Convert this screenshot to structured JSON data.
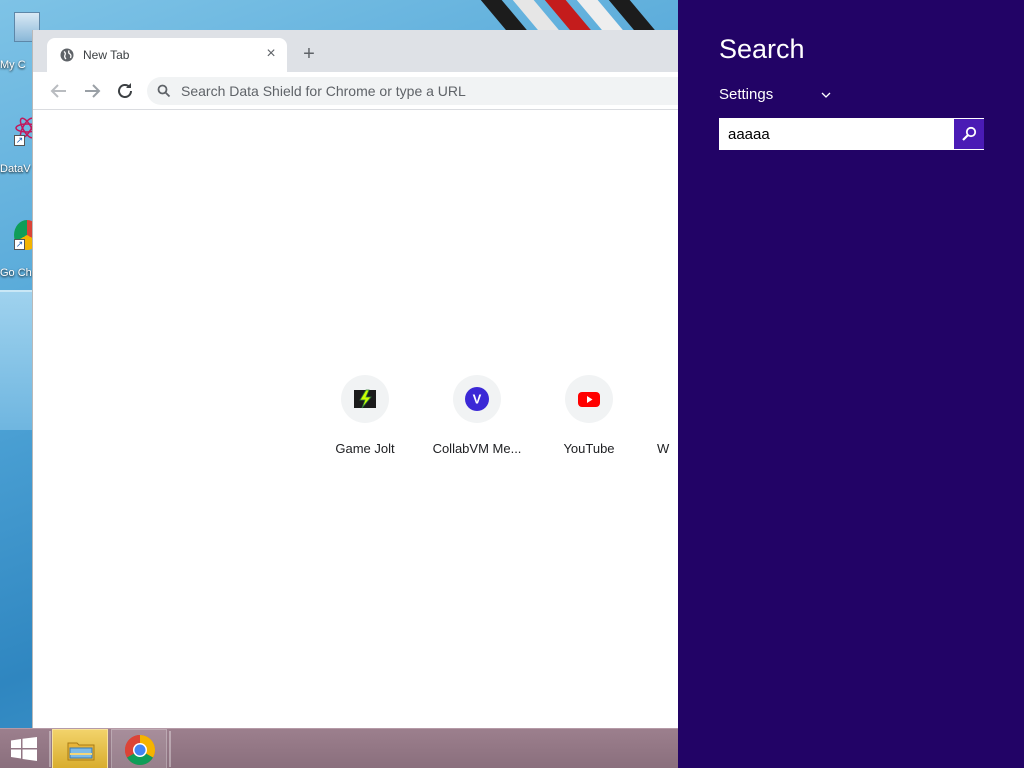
{
  "desktop": {
    "icons": [
      {
        "label": "My C",
        "icon": "my-computer-icon"
      },
      {
        "label": "DataV",
        "icon": "data-shield-icon"
      },
      {
        "label": "Go Ch",
        "icon": "google-chrome-icon"
      }
    ]
  },
  "browser": {
    "tab": {
      "title": "New Tab",
      "favicon": "globe-icon",
      "close_glyph": "×"
    },
    "new_tab_glyph": "+",
    "omnibox": {
      "placeholder": "Search Data Shield for Chrome or type a URL",
      "value": ""
    },
    "shortcuts": [
      {
        "label": "Game Jolt",
        "icon": "game-jolt-icon"
      },
      {
        "label": "CollabVM Me...",
        "icon": "collabvm-icon",
        "glyph": "V",
        "color": "#3b28d6"
      },
      {
        "label": "YouTube",
        "icon": "youtube-icon",
        "color": "#ff0000"
      },
      {
        "label": "W",
        "icon": "partial-shortcut-icon"
      }
    ]
  },
  "taskbar": {
    "items": [
      {
        "name": "start",
        "icon": "windows-logo-icon"
      },
      {
        "name": "file-explorer",
        "icon": "folder-icon"
      },
      {
        "name": "google-chrome",
        "icon": "chrome-icon"
      }
    ]
  },
  "search_charm": {
    "title": "Search",
    "scope_label": "Settings",
    "query": "aaaaa",
    "background_color": "#220366",
    "button_color": "#4a1bb5"
  }
}
